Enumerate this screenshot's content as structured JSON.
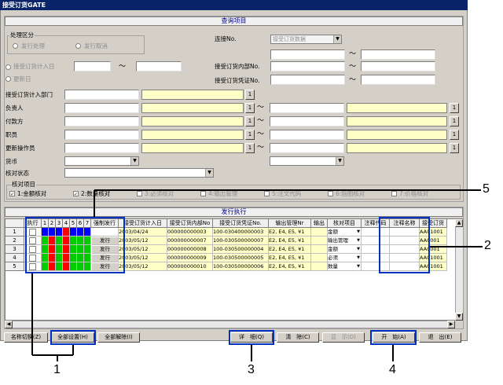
{
  "title": "接受订货GATE",
  "query_section_title": "查询项目",
  "process_group": {
    "label": "处理区分",
    "opt1": "发行处理",
    "opt2": "发行取消"
  },
  "dates": {
    "label": "接受订货计入日",
    "tilde": "～",
    "update": "更新日"
  },
  "connect": {
    "label": "连接No.",
    "value": "接受订货数据"
  },
  "internal_no": "接受订货内部No.",
  "voucher_no": "接受订货凭证No.",
  "fields": [
    "接受订货计入部门",
    "负责人",
    "付款方",
    "职员",
    "更新操作员",
    "货币",
    "核对状态"
  ],
  "tilde": "～",
  "btn_one": "1",
  "check_group": {
    "label": "核对项目",
    "items": [
      "1:金额核对",
      "2:数量核对",
      "3:必须核对",
      "4:输出管理",
      "5:注文代码",
      "6:指图核对",
      "7:价格核对"
    ]
  },
  "exec_section_title": "发行执行",
  "grid": {
    "headers": [
      "执行",
      "1",
      "2",
      "3",
      "4",
      "5",
      "6",
      "7",
      "强制发行",
      "接受订货计入日",
      "接受订货内部No",
      "接受订货凭证No.",
      "输出管理Nr",
      "输出",
      "核对项目",
      "注释代码",
      "注释名称",
      "接受订货"
    ],
    "rows": [
      {
        "no": "1",
        "force": "",
        "date": "2003/04/24",
        "internal": "000000000003",
        "voucher": "100-030400000003",
        "output": "E2, E4, E5, ¥1",
        "check": "金额",
        "code": "",
        "name": "",
        "extra": "AA01001"
      },
      {
        "no": "2",
        "force": "发行",
        "date": "2003/05/12",
        "internal": "000000000007",
        "voucher": "100-030500000007",
        "output": "E2, E4, E5, ¥1",
        "check": "输出管理",
        "code": "",
        "name": "",
        "extra": "AA0001"
      },
      {
        "no": "3",
        "force": "发行",
        "date": "2003/05/12",
        "internal": "000000000008",
        "voucher": "100-030500000004",
        "output": "E2, E4, E5, ¥1",
        "check": "金额",
        "code": "",
        "name": "",
        "extra": "AA0001"
      },
      {
        "no": "4",
        "force": "发行",
        "date": "2003/05/12",
        "internal": "000000000009",
        "voucher": "100-030500000005",
        "output": "E2, E4, E5, ¥1",
        "check": "必须",
        "code": "",
        "name": "",
        "extra": "AA01001"
      },
      {
        "no": "5",
        "force": "发行",
        "date": "2003/05/12",
        "internal": "000000000010",
        "voucher": "100-030500000006",
        "output": "E2, E4, E5, ¥1",
        "check": "数量",
        "code": "",
        "name": "",
        "extra": "AA01001"
      }
    ],
    "colors": [
      [
        "#0000ff",
        "#0000ff",
        "#0000ff",
        "#ff0000",
        "#0000ff",
        "#0000ff",
        "#0000ff"
      ],
      [
        "#00cc00",
        "#ff0000",
        "#00cc00",
        "#ff0000",
        "#00cc00",
        "#00cc00",
        "#00cc00"
      ],
      [
        "#00cc00",
        "#ff0000",
        "#00cc00",
        "#ff0000",
        "#00cc00",
        "#00cc00",
        "#00cc00"
      ],
      [
        "#00cc00",
        "#ff0000",
        "#00cc00",
        "#ff0000",
        "#00cc00",
        "#00cc00",
        "#00cc00"
      ],
      [
        "#00cc00",
        "#ff0000",
        "#00cc00",
        "#ff0000",
        "#00cc00",
        "#00cc00",
        "#00cc00"
      ]
    ]
  },
  "bottom_buttons": {
    "name_switch": "名称切换(Z)",
    "select_all": "全部设置(H)",
    "clear_all": "全部解除(I)",
    "detail": "详　细(Q)",
    "clear": "清　除(C)",
    "display": "显　示(D)",
    "start": "开　始(A)",
    "exit": "退　出(E)"
  },
  "annotations": [
    "1",
    "2",
    "3",
    "4",
    "5"
  ]
}
